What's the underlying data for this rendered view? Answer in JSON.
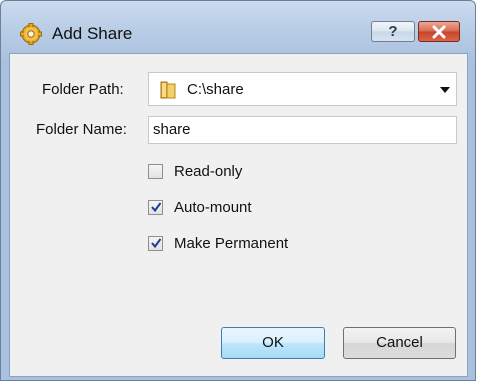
{
  "window": {
    "title": "Add Share",
    "title_icon": "gear-folder-icon",
    "help_label": "?",
    "close_icon": "close-icon"
  },
  "form": {
    "folder_path_label": "Folder Path:",
    "folder_path_value": "C:\\share",
    "folder_path_icon": "folder-icon",
    "folder_name_label": "Folder Name:",
    "folder_name_value": "share"
  },
  "options": [
    {
      "label": "Read-only",
      "checked": false
    },
    {
      "label": "Auto-mount",
      "checked": true
    },
    {
      "label": "Make Permanent",
      "checked": true
    }
  ],
  "buttons": {
    "ok_label": "OK",
    "cancel_label": "Cancel"
  },
  "colors": {
    "title_gradient_top": "#cbdcf0",
    "close_button": "#c8442a",
    "ok_button_border": "#3c7fb1",
    "client_background": "#f0f0f0"
  }
}
